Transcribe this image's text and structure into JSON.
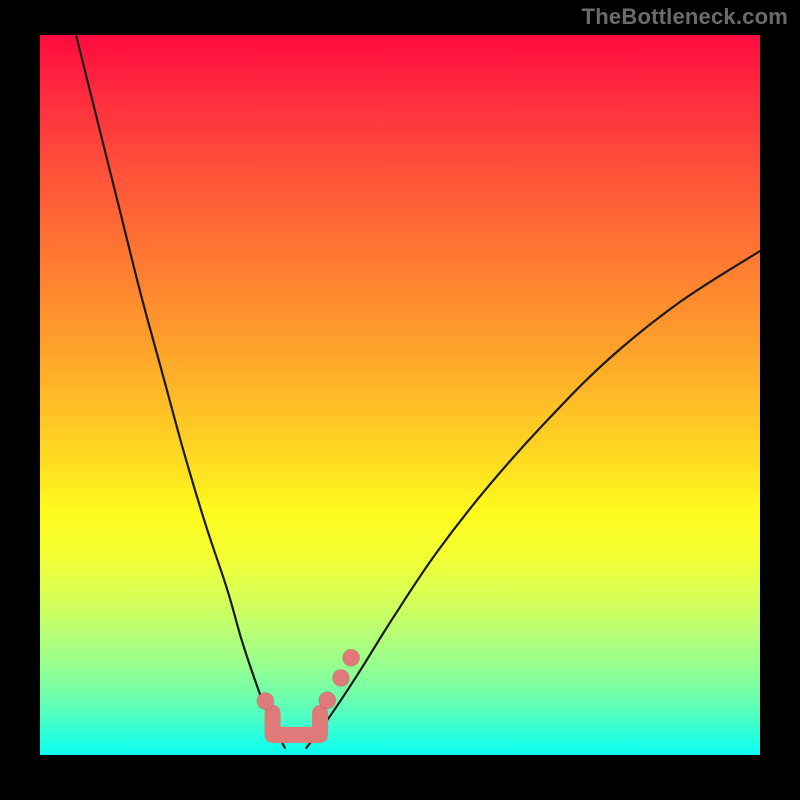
{
  "watermark": "TheBottleneck.com",
  "chart_data": {
    "type": "line",
    "title": "",
    "xlabel": "",
    "ylabel": "",
    "xlim": [
      0,
      100
    ],
    "ylim": [
      0,
      100
    ],
    "curve_left": {
      "x": [
        5,
        8,
        11,
        14,
        17,
        20,
        23,
        26,
        28,
        30,
        31.5,
        33,
        34
      ],
      "y": [
        100,
        88,
        76,
        64,
        53,
        42,
        32,
        23,
        16,
        10,
        6,
        3,
        1
      ]
    },
    "curve_right": {
      "x": [
        37,
        40,
        44,
        49,
        55,
        62,
        70,
        79,
        89,
        100
      ],
      "y": [
        1,
        5,
        11,
        19,
        28,
        37,
        46,
        55,
        63,
        70
      ]
    },
    "markers": [
      {
        "x": 31.3,
        "y": 7.5
      },
      {
        "x": 39.9,
        "y": 7.6
      },
      {
        "x": 41.8,
        "y": 10.7
      },
      {
        "x": 43.2,
        "y": 13.5
      }
    ],
    "valley_flat": {
      "x_start": 32.3,
      "x_end": 38.9,
      "y": 2.8
    },
    "gradient_stops": [
      {
        "pos": 0,
        "color": "#ff0b3e"
      },
      {
        "pos": 18,
        "color": "#ff4e3a"
      },
      {
        "pos": 38,
        "color": "#ff8f2e"
      },
      {
        "pos": 58,
        "color": "#ffd722"
      },
      {
        "pos": 72,
        "color": "#f4ff32"
      },
      {
        "pos": 88,
        "color": "#93ff92"
      },
      {
        "pos": 100,
        "color": "#0dfff1"
      }
    ]
  }
}
